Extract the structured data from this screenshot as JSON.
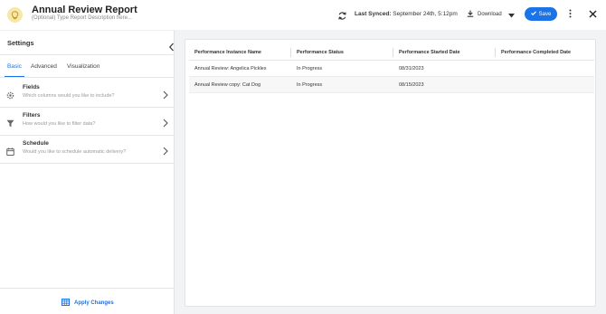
{
  "header": {
    "title": "Annual Review Report",
    "description_placeholder": "(Optional) Type Report Description here...",
    "last_synced_label": "Last Synced:",
    "last_synced_value": "September 24th, 5:12pm",
    "download_label": "Download",
    "save_label": "Save"
  },
  "sidebar": {
    "title": "Settings",
    "tabs": [
      {
        "label": "Basic",
        "active": true
      },
      {
        "label": "Advanced",
        "active": false
      },
      {
        "label": "Visualization",
        "active": false
      }
    ],
    "items": [
      {
        "title": "Fields",
        "subtitle": "Which columns would you like to include?",
        "icon": "gear-icon"
      },
      {
        "title": "Filters",
        "subtitle": "How would you like to filter data?",
        "icon": "filter-icon"
      },
      {
        "title": "Schedule",
        "subtitle": "Would you like to schedule automatic delivery?",
        "icon": "calendar-icon"
      }
    ],
    "apply_label": "Apply Changes"
  },
  "table": {
    "columns": [
      "Performance Instance Name",
      "Performance Status",
      "Performance Started Date",
      "Performance Completed Date"
    ],
    "rows": [
      [
        "Annual Review: Angelica Pickles",
        "In Progress",
        "08/31/2023",
        ""
      ],
      [
        "Annual Review copy: Cat Dog",
        "In Progress",
        "08/15/2023",
        ""
      ]
    ]
  },
  "colors": {
    "accent": "#1a73e8",
    "bulb_bg": "#f7e7a8",
    "bulb_fg": "#d6a21a",
    "main_bg": "#f2f3f5"
  }
}
